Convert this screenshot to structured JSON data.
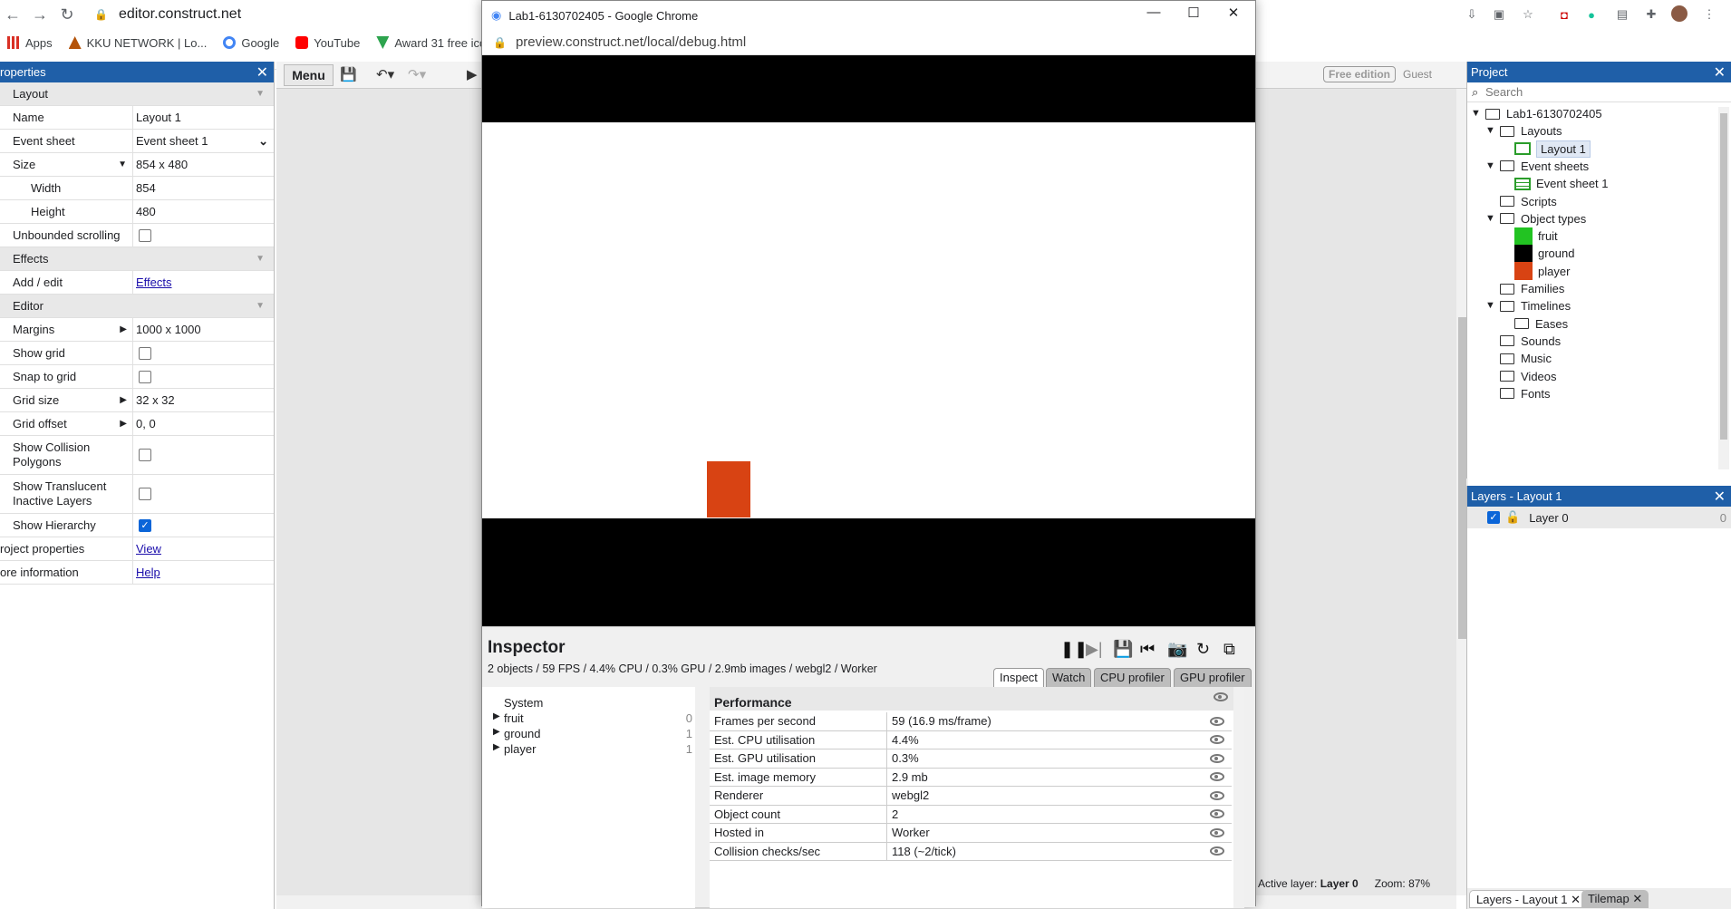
{
  "browser": {
    "url": "editor.construct.net",
    "bookmarks": [
      "Apps",
      "KKU NETWORK | Lo...",
      "Google",
      "YouTube",
      "Award 31 free icons..."
    ]
  },
  "properties": {
    "title": "roperties",
    "rows": [
      {
        "type": "section",
        "label": "Layout"
      },
      {
        "label": "Name",
        "value": "Layout 1"
      },
      {
        "label": "Event sheet",
        "value": "Event sheet 1",
        "dropdown": true
      },
      {
        "label": "Size",
        "value": "854 x 480",
        "expander": "down"
      },
      {
        "label": "Width",
        "value": "854",
        "sub": true
      },
      {
        "label": "Height",
        "value": "480",
        "sub": true
      },
      {
        "label": "Unbounded scrolling",
        "check": false
      },
      {
        "type": "section",
        "label": "Effects"
      },
      {
        "label": "Add / edit",
        "link": "Effects"
      },
      {
        "type": "section",
        "label": "Editor"
      },
      {
        "label": "Margins",
        "value": "1000 x 1000",
        "expander": "right"
      },
      {
        "label": "Show grid",
        "check": false
      },
      {
        "label": "Snap to grid",
        "check": false
      },
      {
        "label": "Grid size",
        "value": "32 x 32",
        "expander": "right"
      },
      {
        "label": "Grid offset",
        "value": "0, 0",
        "expander": "right"
      },
      {
        "label": "Show Collision Polygons",
        "check": false,
        "tall": true
      },
      {
        "label": "Show Translucent Inactive Layers",
        "check": false,
        "tall": true
      },
      {
        "label": "Show Hierarchy",
        "check": true
      },
      {
        "label": "roject properties",
        "link": "View",
        "flush": true
      },
      {
        "label": "ore information",
        "link": "Help",
        "flush": true
      }
    ]
  },
  "toolbar": {
    "menu": "Menu",
    "free_edition": "Free edition",
    "guest": "Guest"
  },
  "status": {
    "active_layer_label": "Active layer:",
    "active_layer": "Layer 0",
    "zoom": "Zoom: 87%"
  },
  "popup": {
    "title": "Lab1-6130702405 - Google Chrome",
    "url": "preview.construct.net/local/debug.html"
  },
  "inspector": {
    "title": "Inspector",
    "stats": "2 objects / 59 FPS / 4.4% CPU / 0.3% GPU / 2.9mb images / webgl2 / Worker",
    "tabs": [
      "Inspect",
      "Watch",
      "CPU profiler",
      "GPU profiler"
    ],
    "tree": [
      {
        "name": "System",
        "count": ""
      },
      {
        "name": "fruit",
        "count": "0"
      },
      {
        "name": "ground",
        "count": "1"
      },
      {
        "name": "player",
        "count": "1"
      }
    ],
    "perf_title": "Performance",
    "perf": [
      {
        "k": "Frames per second",
        "v": "59 (16.9 ms/frame)"
      },
      {
        "k": "Est. CPU utilisation",
        "v": "4.4%"
      },
      {
        "k": "Est. GPU utilisation",
        "v": "0.3%"
      },
      {
        "k": "Est. image memory",
        "v": "2.9 mb"
      },
      {
        "k": "Renderer",
        "v": "webgl2"
      },
      {
        "k": "Object count",
        "v": "2"
      },
      {
        "k": "Hosted in",
        "v": "Worker"
      },
      {
        "k": "Collision checks/sec",
        "v": "118 (~2/tick)"
      }
    ]
  },
  "project": {
    "title": "Project",
    "search_placeholder": "Search",
    "items": [
      {
        "label": "Lab1-6130702405",
        "kind": "folder",
        "level": 0,
        "open": true
      },
      {
        "label": "Layouts",
        "kind": "folder",
        "level": 1,
        "open": true
      },
      {
        "label": "Layout 1",
        "kind": "layout",
        "level": 2
      },
      {
        "label": "Event sheets",
        "kind": "folder",
        "level": 1,
        "open": true
      },
      {
        "label": "Event sheet 1",
        "kind": "eventsheet",
        "level": 2
      },
      {
        "label": "Scripts",
        "kind": "folder",
        "level": 1
      },
      {
        "label": "Object types",
        "kind": "folder",
        "level": 1,
        "open": true
      },
      {
        "label": "fruit",
        "kind": "sprite",
        "level": 2,
        "color": "#22c322"
      },
      {
        "label": "ground",
        "kind": "sprite",
        "level": 2,
        "color": "#000000"
      },
      {
        "label": "player",
        "kind": "sprite",
        "level": 2,
        "color": "#d84313"
      },
      {
        "label": "Families",
        "kind": "folder",
        "level": 1
      },
      {
        "label": "Timelines",
        "kind": "folder",
        "level": 1,
        "open": true
      },
      {
        "label": "Eases",
        "kind": "folder",
        "level": 2
      },
      {
        "label": "Sounds",
        "kind": "folder",
        "level": 1
      },
      {
        "label": "Music",
        "kind": "folder",
        "level": 1
      },
      {
        "label": "Videos",
        "kind": "folder",
        "level": 1
      },
      {
        "label": "Fonts",
        "kind": "folder",
        "level": 1
      }
    ]
  },
  "layers": {
    "title": "Layers - Layout 1",
    "rows": [
      {
        "label": "Layer 0",
        "index": "0"
      }
    ],
    "bottom_tabs": [
      "Layers - Layout 1",
      "Tilemap"
    ]
  },
  "colors": {
    "panel_header": "#1f5fa8",
    "player": "#d84313",
    "fruit": "#22c322",
    "checkbox": "#0b65d8"
  }
}
